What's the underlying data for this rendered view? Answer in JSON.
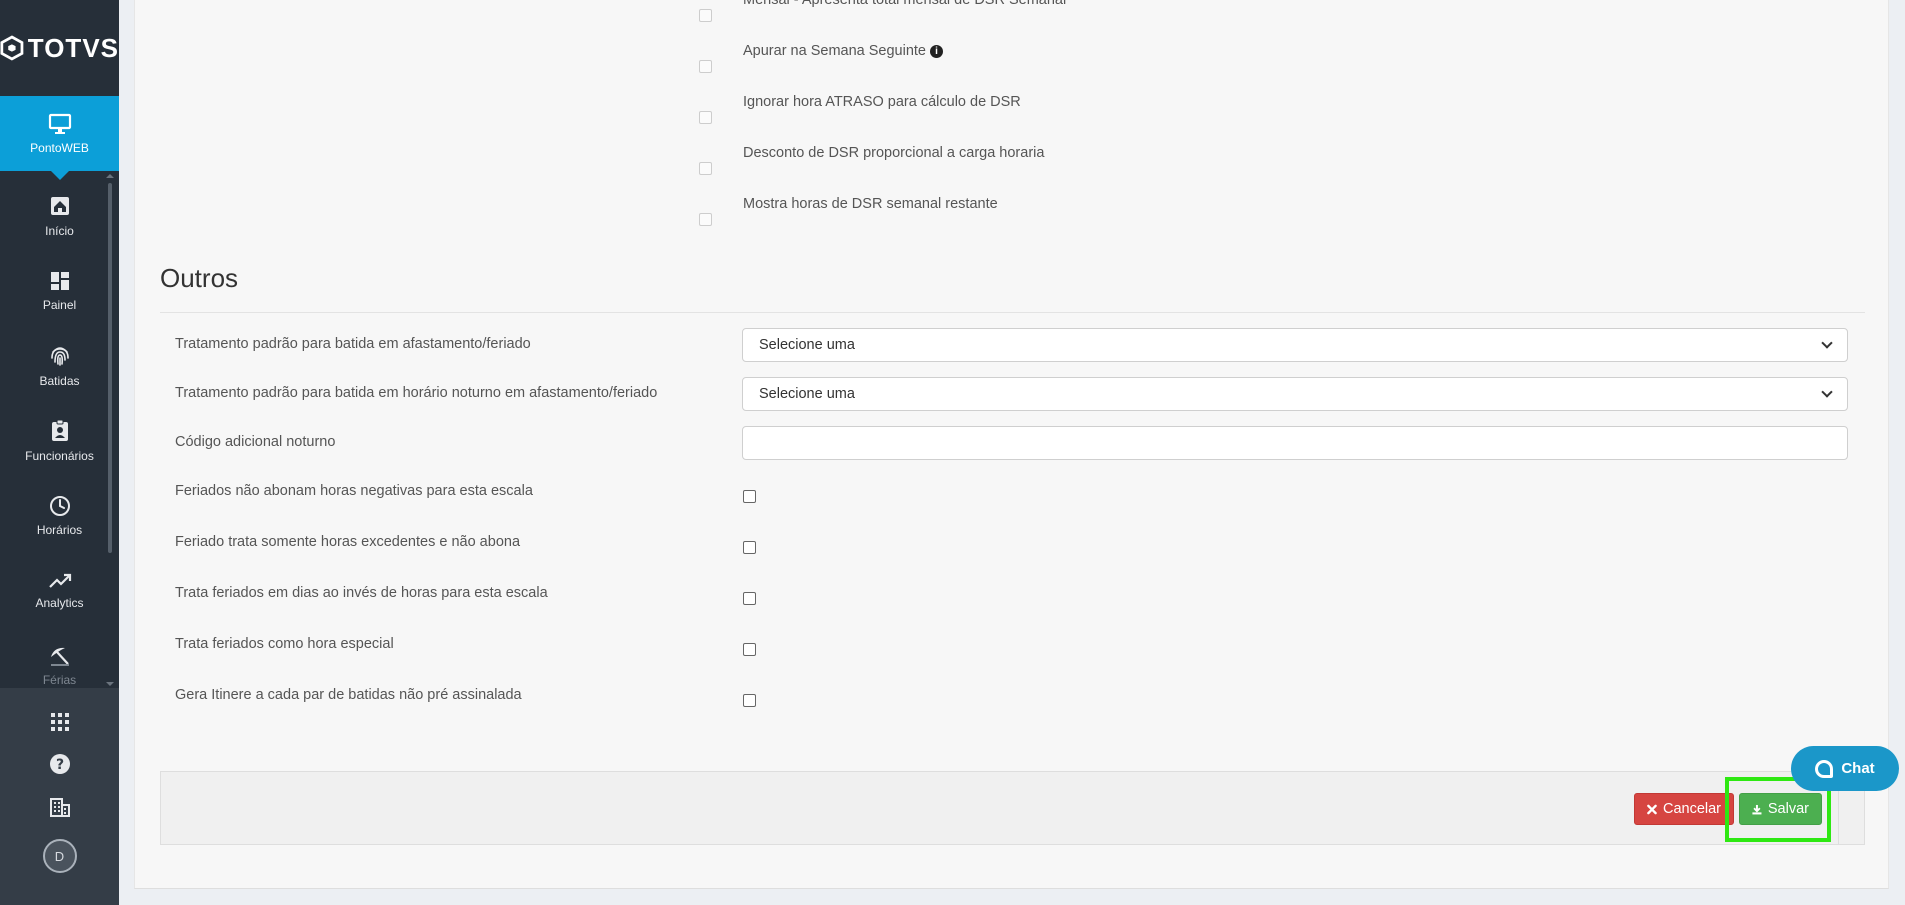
{
  "brand": {
    "logo_text": "TOTVS"
  },
  "sidebar": {
    "active_module": "PontoWEB",
    "items": [
      {
        "label": "Início",
        "icon": "home-icon"
      },
      {
        "label": "Painel",
        "icon": "dashboard-icon"
      },
      {
        "label": "Batidas",
        "icon": "fingerprint-icon"
      },
      {
        "label": "Funcionários",
        "icon": "badge-icon"
      },
      {
        "label": "Horários",
        "icon": "clock-icon"
      },
      {
        "label": "Analytics",
        "icon": "trending-up-icon"
      },
      {
        "label": "Férias",
        "icon": "beach-umbrella-icon"
      }
    ],
    "bottom": {
      "apps_icon": "apps-grid-icon",
      "help_icon": "help-icon",
      "company_icon": "building-icon",
      "avatar_initial": "D"
    }
  },
  "dsr_options": [
    {
      "label": "Mensal - Apresenta total mensal de DSR Semanal",
      "checked": false
    },
    {
      "label": "Apurar na Semana Seguinte",
      "checked": false,
      "has_info": true
    },
    {
      "label": "Ignorar hora ATRASO para cálculo de DSR",
      "checked": false
    },
    {
      "label": "Desconto de DSR proporcional a carga horaria",
      "checked": false
    },
    {
      "label": "Mostra horas de DSR semanal restante",
      "checked": false
    }
  ],
  "outros": {
    "title": "Outros",
    "fields": {
      "tratamento_afastamento": {
        "label": "Tratamento padrão para batida em afastamento/feriado",
        "value": "Selecione uma"
      },
      "tratamento_noturno": {
        "label": "Tratamento padrão para batida em horário noturno em afastamento/feriado",
        "value": "Selecione uma"
      },
      "codigo_adicional": {
        "label": "Código adicional noturno",
        "value": ""
      },
      "feriados_nao_abonam": {
        "label": "Feriados não abonam horas negativas para esta escala",
        "checked": false
      },
      "feriado_excedentes": {
        "label": "Feriado trata somente horas excedentes e não abona",
        "checked": false
      },
      "feriados_dias": {
        "label": "Trata feriados em dias ao invés de horas para esta escala",
        "checked": false
      },
      "feriados_especial": {
        "label": "Trata feriados como hora especial",
        "checked": false
      },
      "gera_itinere": {
        "label": "Gera Itinere a cada par de batidas não pré assinalada",
        "checked": false
      }
    }
  },
  "actions": {
    "cancel_label": "Cancelar",
    "save_label": "Salvar"
  },
  "chat": {
    "label": "Chat"
  },
  "colors": {
    "accent": "#0c9fd8",
    "sidebar_bg": "#262f39",
    "cancel": "#d64541",
    "save": "#4caf50",
    "highlight": "#2ee812"
  }
}
